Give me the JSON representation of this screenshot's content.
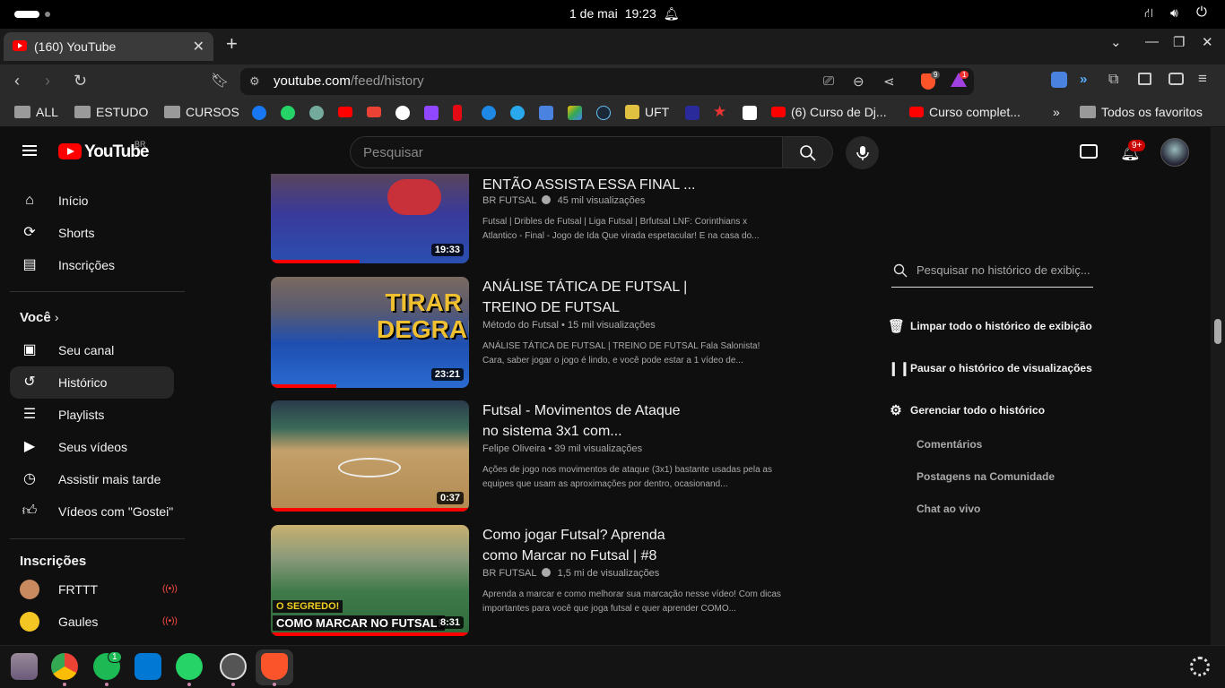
{
  "system": {
    "date": "1 de mai",
    "time": "19:23"
  },
  "browser": {
    "tab_title": "(160) YouTube",
    "url_host": "youtube.com",
    "url_path": "/feed/history",
    "brave_badge": "9",
    "ext_badge": "1",
    "bookmarks": [
      "ALL",
      "ESTUDO",
      "CURSOS",
      "UFT",
      "(6) Curso de Dj...",
      "Curso complet...",
      "»",
      "Todos os favoritos"
    ]
  },
  "youtube": {
    "logo_text": "YouTube",
    "country": "BR",
    "search_placeholder": "Pesquisar",
    "notifications": "9+"
  },
  "sidebar": {
    "main": [
      {
        "label": "Início",
        "icon": "home-icon"
      },
      {
        "label": "Shorts",
        "icon": "shorts-icon"
      },
      {
        "label": "Inscrições",
        "icon": "subscriptions-icon"
      }
    ],
    "you_heading": "Você",
    "you_items": [
      {
        "label": "Seu canal",
        "icon": "channel-icon"
      },
      {
        "label": "Histórico",
        "icon": "history-icon"
      },
      {
        "label": "Playlists",
        "icon": "playlists-icon"
      },
      {
        "label": "Seus vídeos",
        "icon": "your-videos-icon"
      },
      {
        "label": "Assistir mais tarde",
        "icon": "watch-later-icon"
      },
      {
        "label": "Vídeos com \"Gostei\"",
        "icon": "like-icon"
      }
    ],
    "subs_heading": "Inscrições",
    "subs": [
      {
        "label": "FRTTT"
      },
      {
        "label": "Gaules"
      }
    ]
  },
  "videos": [
    {
      "title": "ENTÃO ASSISTA ESSA FINAL ...",
      "channel": "BR FUTSAL",
      "verified": true,
      "views": "45 mil visualizações",
      "description": "Futsal | Dribles de Futsal | Liga Futsal | Brfutsal LNF: Corinthians x Atlantico - Final - Jogo de Ida Que virada espetacular! E na casa do...",
      "duration": "19:33",
      "progress": 0.45,
      "thumb_colors": [
        "#2a3f9a",
        "#c8303a"
      ]
    },
    {
      "title": "ANÁLISE TÁTICA DE FUTSAL | TREINO DE FUTSAL",
      "channel": "Método do Futsal",
      "verified": false,
      "views": "15 mil visualizações",
      "description": "ANÁLISE TÁTICA DE FUTSAL | TREINO DE FUTSAL Fala Salonista! Cara, saber jogar o jogo é lindo, e você pode estar a 1 vídeo de...",
      "duration": "23:21",
      "progress": 0.33,
      "overlay_text": [
        "TIRAR",
        "DEGRAU"
      ],
      "thumb_colors": [
        "#1e4fb0",
        "#2a6ad0"
      ]
    },
    {
      "title": "Futsal - Movimentos de Ataque no sistema 3x1 com...",
      "channel": "Felipe Oliveira",
      "verified": false,
      "views": "39 mil visualizações",
      "description": "Ações de jogo nos movimentos de ataque (3x1) bastante usadas pela as equipes que usam as aproximações por dentro, ocasionand...",
      "duration": "0:37",
      "progress": 1.0,
      "thumb_colors": [
        "#b8935a",
        "#8a6a3a"
      ]
    },
    {
      "title": "Como jogar Futsal? Aprenda como Marcar no Futsal | #8",
      "channel": "BR FUTSAL",
      "verified": true,
      "views": "1,5 mi de visualizações",
      "description": "Aprenda a marcar e como melhorar sua marcação nesse vídeo! Com dicas importantes para você que joga futsal e quer aprender COMO...",
      "duration": "8:31",
      "progress": 1.0,
      "overlay_text": [
        "O SEGREDO!",
        "COMO MARCAR NO FUTSAL!"
      ],
      "thumb_colors": [
        "#3f7a4a",
        "#c8a030"
      ]
    }
  ],
  "right_panel": {
    "search_placeholder": "Pesquisar no histórico de exibiç...",
    "actions": [
      {
        "label": "Limpar todo o histórico de exibição",
        "icon": "trash-icon"
      },
      {
        "label": "Pausar o histórico de visualizações",
        "icon": "pause-icon"
      },
      {
        "label": "Gerenciar todo o histórico",
        "icon": "gear-icon"
      }
    ],
    "sub_links": [
      "Comentários",
      "Postagens na Comunidade",
      "Chat ao vivo"
    ]
  },
  "dock": {
    "spotify_badge": "1"
  }
}
